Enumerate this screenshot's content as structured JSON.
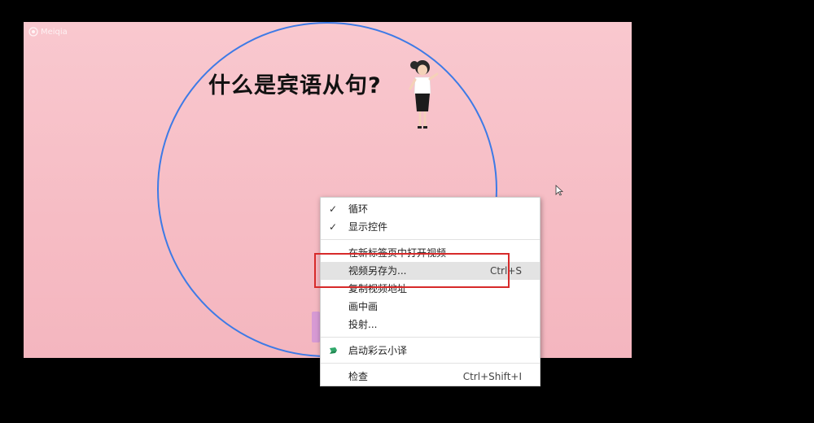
{
  "watermark": {
    "text": "Meiqia"
  },
  "slide": {
    "title": "什么是宾语从句?"
  },
  "context_menu": {
    "items": [
      {
        "label": "循环",
        "checked": true,
        "shortcut": ""
      },
      {
        "label": "显示控件",
        "checked": true,
        "shortcut": ""
      },
      {
        "label": "在新标签页中打开视频",
        "checked": false,
        "shortcut": ""
      },
      {
        "label": "视频另存为...",
        "checked": false,
        "shortcut": "Ctrl+S"
      },
      {
        "label": "复制视频地址",
        "checked": false,
        "shortcut": ""
      },
      {
        "label": "画中画",
        "checked": false,
        "shortcut": ""
      },
      {
        "label": "投射...",
        "checked": false,
        "shortcut": ""
      },
      {
        "label": "启动彩云小译",
        "checked": false,
        "shortcut": "",
        "icon": "flag-icon"
      },
      {
        "label": "检查",
        "checked": false,
        "shortcut": "Ctrl+Shift+I"
      }
    ],
    "check_glyph": "✓"
  },
  "colors": {
    "video_bg": "#f6bcc4",
    "circle": "#3d7ae6",
    "highlight": "#d72a2a",
    "menu_hover": "#e3e3e3",
    "flag": "#2fa86a"
  }
}
